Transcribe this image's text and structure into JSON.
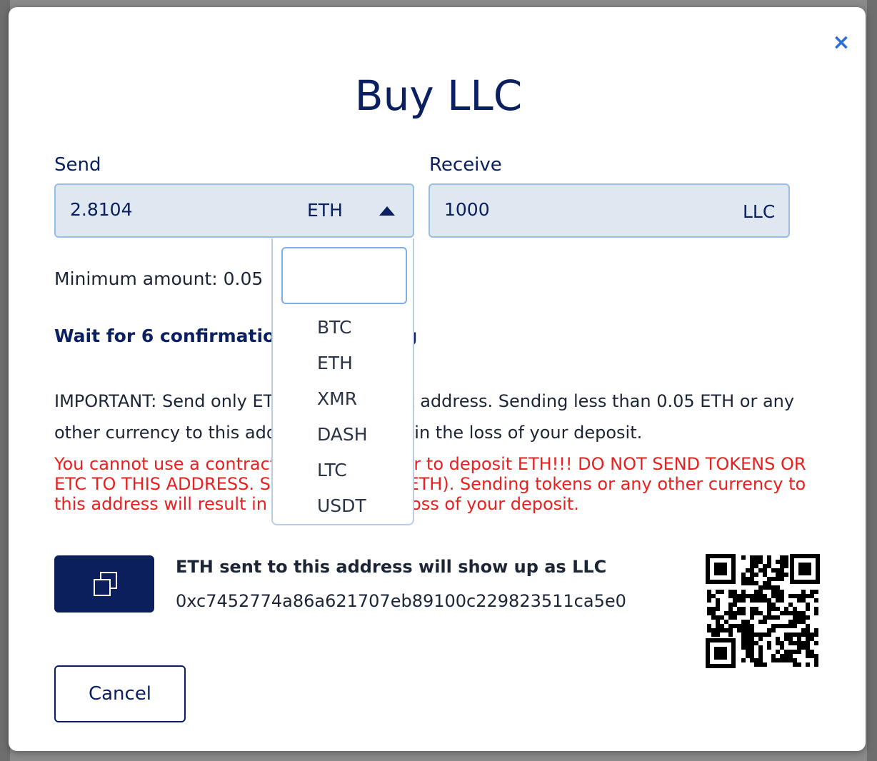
{
  "modal": {
    "title": "Buy LLC",
    "close_symbol": "×"
  },
  "send": {
    "label": "Send",
    "value": "2.8104",
    "currency": "ETH"
  },
  "receive": {
    "label": "Receive",
    "value": "1000",
    "currency": "LLC"
  },
  "minimum_text": "Minimum amount: 0.05",
  "wait_text": "Wait for 6 confirmations for funding",
  "important_text": "IMPORTANT: Send only ETH to this deposit address. Sending less than 0.05 ETH or any other currency to this address may result in the loss of your deposit.",
  "warning_text": "You cannot use a contract internal transfer to deposit ETH!!! DO NOT SEND TOKENS OR ETC TO THIS ADDRESS. Send only Ether (ETH). Sending tokens or any other currency to this address will result in the permanent loss of your deposit.",
  "address": {
    "heading": "ETH sent to this address will show up as LLC",
    "value": "0xc7452774a86a621707eb89100c229823511ca5e0"
  },
  "cancel_label": "Cancel",
  "dropdown": {
    "search_value": "",
    "options": [
      "BTC",
      "ETH",
      "XMR",
      "DASH",
      "LTC",
      "USDT"
    ]
  },
  "icons": {
    "close": "close-icon",
    "caret": "caret-up-icon",
    "copy": "copy-icon",
    "qr": "qr-code"
  },
  "colors": {
    "title": "#0a2060",
    "primary_button": "#0a1f5c",
    "warning": "#e82020",
    "close": "#2b6fd6",
    "field_bg": "#dfe7f1",
    "field_border": "#97bde6"
  }
}
